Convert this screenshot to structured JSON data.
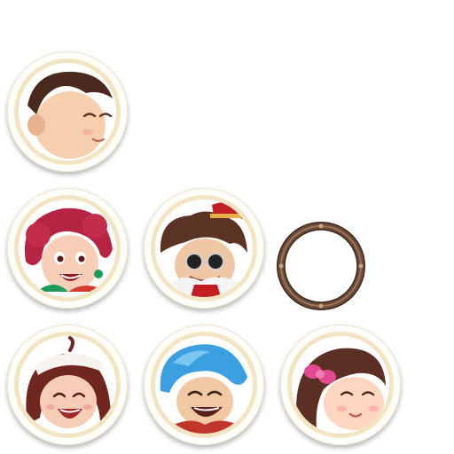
{
  "sprite_sheet": {
    "background": "#ffffff",
    "avatars": [
      {
        "name": "boy-brown-hair",
        "row": 1,
        "col": 1,
        "skin": "#f6cfae",
        "hair": "#4a2a1e",
        "accent": "#7a3f27"
      },
      {
        "name": "girl-red-curly-hair",
        "row": 2,
        "col": 1,
        "skin": "#f7cfb8",
        "hair": "#b52442",
        "accent": "#1f9a5a"
      },
      {
        "name": "old-man-sunglasses-red-hat",
        "row": 2,
        "col": 2,
        "skin": "#efc7a4",
        "hair": "#5b3324",
        "accent": "#c21f25"
      },
      {
        "name": "girl-brown-hair-maid",
        "row": 3,
        "col": 1,
        "skin": "#f6cdb7",
        "hair": "#6f2720",
        "accent": "#f6f3ef"
      },
      {
        "name": "boy-blue-hair-laughing",
        "row": 3,
        "col": 2,
        "skin": "#f0c8a3",
        "hair": "#3b9fe0",
        "accent": "#c0362c"
      },
      {
        "name": "girl-pink-bow",
        "row": 3,
        "col": 3,
        "skin": "#ffd6bf",
        "hair": "#5c2f24",
        "accent": "#e04b92"
      }
    ],
    "frame": {
      "name": "bronze-ring-frame",
      "row": 2,
      "col": 3,
      "color": "#6b4a38"
    }
  }
}
